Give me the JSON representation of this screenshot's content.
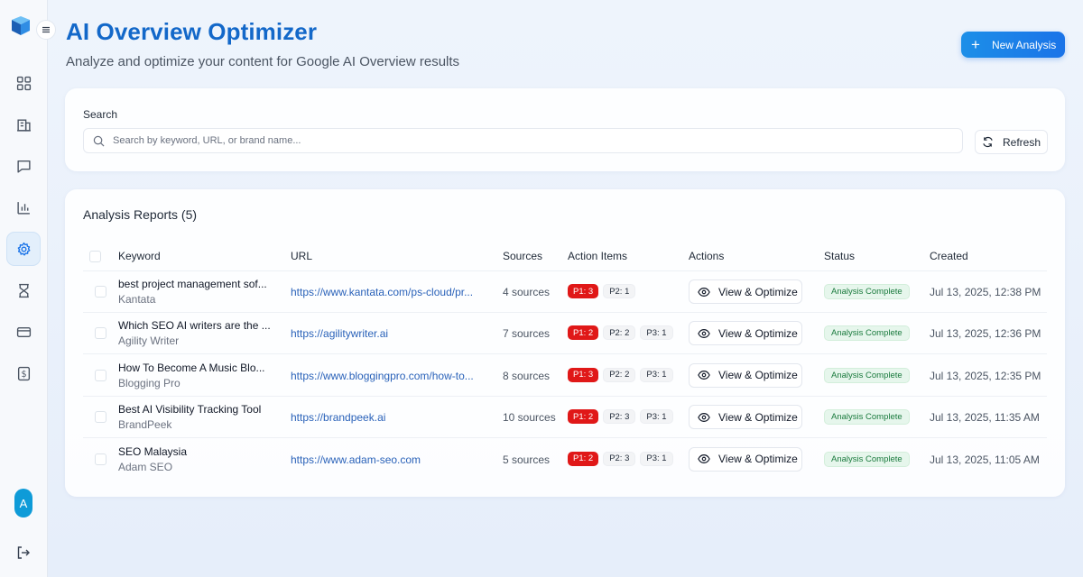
{
  "header": {
    "title": "AI Overview Optimizer",
    "subtitle": "Analyze and optimize your content for Google AI Overview results",
    "new_button_label": "New Analysis"
  },
  "sidebar": {
    "items": [
      {
        "name": "dashboard",
        "icon": "grid-icon"
      },
      {
        "name": "brands",
        "icon": "building-icon"
      },
      {
        "name": "prompts",
        "icon": "message-icon"
      },
      {
        "name": "analytics",
        "icon": "bar-chart-icon"
      },
      {
        "name": "ai-overview",
        "icon": "gear-icon",
        "active": true
      },
      {
        "name": "reports",
        "icon": "hourglass-icon"
      },
      {
        "name": "billing",
        "icon": "credit-card-icon"
      },
      {
        "name": "pricing",
        "icon": "dollar-icon"
      }
    ],
    "avatar_letter": "A"
  },
  "search": {
    "label": "Search",
    "placeholder": "Search by keyword, URL, or brand name...",
    "value": "",
    "refresh_label": "Refresh"
  },
  "reports": {
    "title": "Analysis Reports (5)",
    "columns": {
      "keyword": "Keyword",
      "url": "URL",
      "sources": "Sources",
      "action_items": "Action Items",
      "actions": "Actions",
      "status": "Status",
      "created": "Created"
    },
    "view_label": "View & Optimize",
    "rows": [
      {
        "keyword": "best project management sof...",
        "brand": "Kantata",
        "url": "https://www.kantata.com/ps-cloud/pr...",
        "sources": "4 sources",
        "p1": "P1: 3",
        "p2": "P2: 1",
        "p3": "",
        "status": "Analysis Complete",
        "created": "Jul 13, 2025, 12:38 PM"
      },
      {
        "keyword": "Which SEO AI writers are the ...",
        "brand": "Agility Writer",
        "url": "https://agilitywriter.ai",
        "sources": "7 sources",
        "p1": "P1: 2",
        "p2": "P2: 2",
        "p3": "P3: 1",
        "status": "Analysis Complete",
        "created": "Jul 13, 2025, 12:36 PM"
      },
      {
        "keyword": "How To Become A Music Blo...",
        "brand": "Blogging Pro",
        "url": "https://www.bloggingpro.com/how-to...",
        "sources": "8 sources",
        "p1": "P1: 3",
        "p2": "P2: 2",
        "p3": "P3: 1",
        "status": "Analysis Complete",
        "created": "Jul 13, 2025, 12:35 PM"
      },
      {
        "keyword": "Best AI Visibility Tracking Tool",
        "brand": "BrandPeek",
        "url": "https://brandpeek.ai",
        "sources": "10 sources",
        "p1": "P1: 2",
        "p2": "P2: 3",
        "p3": "P3: 1",
        "status": "Analysis Complete",
        "created": "Jul 13, 2025, 11:35 AM"
      },
      {
        "keyword": "SEO Malaysia",
        "brand": "Adam SEO",
        "url": "https://www.adam-seo.com",
        "sources": "5 sources",
        "p1": "P1: 2",
        "p2": "P2: 3",
        "p3": "P3: 1",
        "status": "Analysis Complete",
        "created": "Jul 13, 2025, 11:05 AM"
      }
    ]
  },
  "colors": {
    "accent": "#1a73e8",
    "title": "#1368c9",
    "p1_badge": "#e01818",
    "status_bg": "#e6f6ec",
    "status_text": "#1a7a3d"
  }
}
